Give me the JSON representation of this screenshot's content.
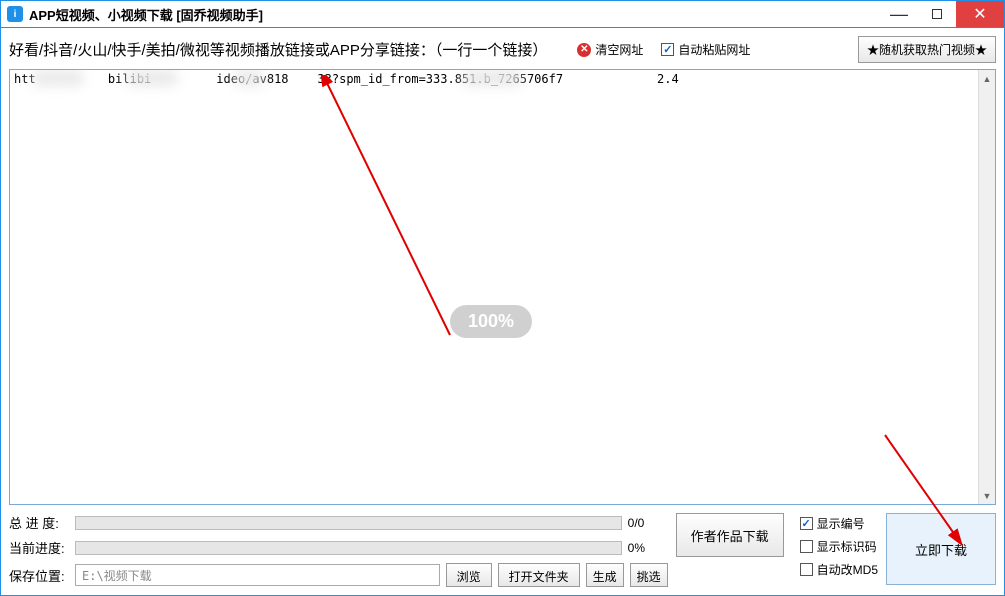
{
  "titlebar": {
    "icon_letter": "i",
    "title": "APP短视频、小视频下载 [固乔视频助手]"
  },
  "top": {
    "instruction": "好看/抖音/火山/快手/美拍/微视等视频播放链接或APP分享链接：（一行一个链接）",
    "clear_label": "清空网址",
    "autopaste_label": "自动粘贴网址",
    "random_label": "★随机获取热门视频★"
  },
  "url_text": "htt          bilibi         ideo/av818    33?spm_id_from=333.851.b_7265706f7             2.4",
  "watermark": "100%",
  "progress": {
    "total_label": "总 进 度:",
    "total_text": "0/0",
    "current_label": "当前进度:",
    "current_text": "0%"
  },
  "path": {
    "label": "保存位置:",
    "value": "E:\\视频下载",
    "browse": "浏览",
    "open_folder": "打开文件夹",
    "generate": "生成",
    "pick": "挑选"
  },
  "author_btn": "作者作品下载",
  "checks": {
    "show_number": "显示编号",
    "show_idcode": "显示标识码",
    "auto_md5": "自动改MD5"
  },
  "download_btn": "立即下载"
}
